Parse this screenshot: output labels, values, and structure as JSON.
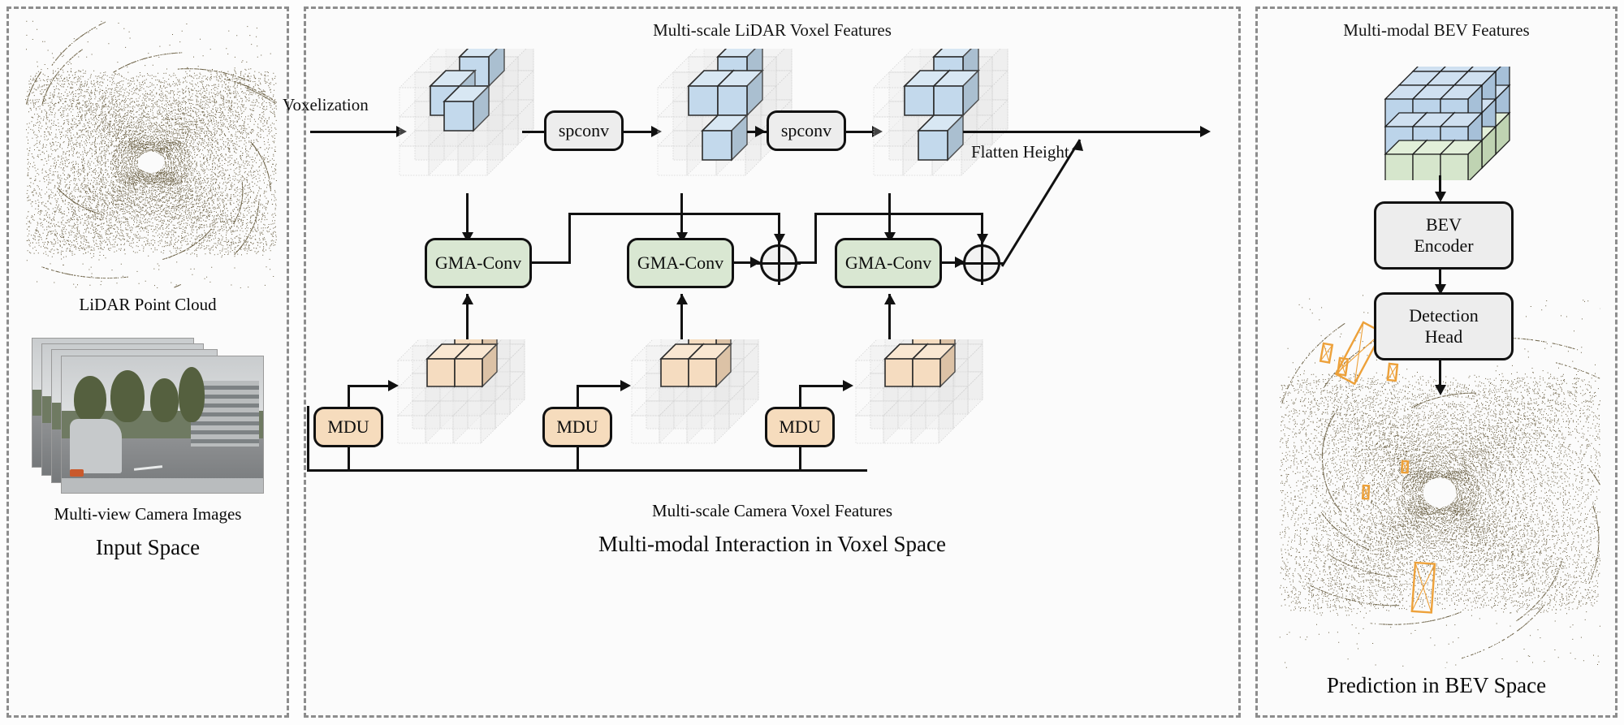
{
  "panels": {
    "input": {
      "cloud_caption": "LiDAR Point Cloud",
      "camera_caption": "Multi-view Camera Images",
      "title": "Input Space"
    },
    "voxel": {
      "top_title": "Multi-scale LiDAR Voxel Features",
      "bottom_subtitle": "Multi-scale Camera Voxel Features",
      "title": "Multi-modal Interaction in Voxel Space"
    },
    "bev": {
      "top_title": "Multi-modal BEV Features",
      "title": "Prediction in BEV Space"
    }
  },
  "labels": {
    "voxelization": "Voxelization",
    "flatten_height": "Flatten Height"
  },
  "blocks": {
    "spconv_1": "spconv",
    "spconv_2": "spconv",
    "gma_conv_1": "GMA-Conv",
    "gma_conv_2": "GMA-Conv",
    "gma_conv_3": "GMA-Conv",
    "mdu_1": "MDU",
    "mdu_2": "MDU",
    "mdu_3": "MDU",
    "bev_encoder": "BEV\nEncoder",
    "bev_encoder_line1": "BEV",
    "bev_encoder_line2": "Encoder",
    "detection_head_line1": "Detection",
    "detection_head_line2": "Head"
  },
  "operators": {
    "sum_1": "⊕",
    "sum_2": "⊕"
  },
  "colors": {
    "lidar_voxel_fill": "#c3d9ec",
    "lidar_voxel_top": "#d8e7f3",
    "lidar_voxel_side": "#aabfd0",
    "camera_voxel_fill": "#f5dcc0",
    "camera_voxel_top": "#f9e7d2",
    "camera_voxel_side": "#dcc2a6",
    "gma_conv_fill": "#d9e7d2",
    "mdu_fill": "#f6dcbd",
    "block_grey_fill": "#ededed",
    "bev_blue": "#bcd4ea",
    "bev_green": "#d6e6cc",
    "panel_border": "#8d8d8d",
    "stroke": "#111111",
    "point_cloud": "#6b6044",
    "detection_box": "#eda13a"
  },
  "voxel_grids": {
    "lidar_stage_1": {
      "grid": [
        3,
        3,
        3
      ],
      "active_voxels": 3
    },
    "lidar_stage_2": {
      "grid": [
        3,
        3,
        3
      ],
      "active_voxels": 4
    },
    "lidar_stage_3": {
      "grid": [
        3,
        3,
        3
      ],
      "active_voxels": 4
    },
    "camera_stage_1": {
      "grid": [
        3,
        3,
        3
      ],
      "active_voxels": 3
    },
    "camera_stage_2": {
      "grid": [
        3,
        3,
        3
      ],
      "active_voxels": 3
    },
    "camera_stage_3": {
      "grid": [
        3,
        3,
        3
      ],
      "active_voxels": 3
    },
    "bev_cube": {
      "grid": [
        3,
        3,
        3
      ],
      "blue_layers": 2,
      "green_layers": 1
    }
  }
}
